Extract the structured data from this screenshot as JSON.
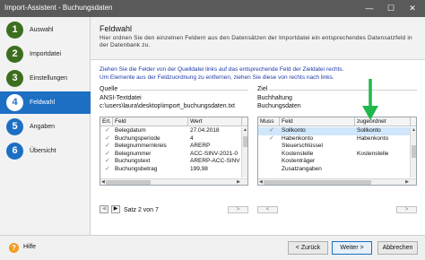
{
  "window": {
    "title": "Import-Assistent - Buchungsdaten",
    "minimize": "—",
    "maximize": "☐",
    "close": "✕"
  },
  "steps": [
    {
      "number": "1",
      "label": "Auswahl"
    },
    {
      "number": "2",
      "label": "Importdatei"
    },
    {
      "number": "3",
      "label": "Einstellungen"
    },
    {
      "number": "4",
      "label": "Feldwahl"
    },
    {
      "number": "5",
      "label": "Angaben"
    },
    {
      "number": "6",
      "label": "Übersicht"
    }
  ],
  "header": {
    "title": "Feldwahl",
    "description": "Hier ordnen Sie den einzelnen Feldern aus den Datensätzen der Importdatei ein entsprechendes Datensatzfeld in der Datenbank zu."
  },
  "instructions": [
    "Ziehen Sie die Felder von der Quelldatei links auf das entsprechende Feld der Zieldatei rechts.",
    "Um Elemente aus der Feldzuordnung zu entfernen, ziehen Sie diese von rechts nach links."
  ],
  "source": {
    "section_label": "Quelle",
    "name": "ANSI-Textdatei",
    "path": "c:\\users\\laura\\desktop\\import_buchungsdaten.txt",
    "columns": [
      "Erl.",
      "Feld",
      "Wert"
    ],
    "rows": [
      {
        "check": "✓",
        "field": "Belegdatum",
        "value": "27.04.2018"
      },
      {
        "check": "✓",
        "field": "Buchungsperiode",
        "value": "4"
      },
      {
        "check": "✓",
        "field": "Belegnummernkreis",
        "value": "ARERP"
      },
      {
        "check": "✓",
        "field": "Belegnummer",
        "value": "ACC-SINV-2021-0"
      },
      {
        "check": "✓",
        "field": "Buchungstext",
        "value": "ARERP-ACC-SINV"
      },
      {
        "check": "✓",
        "field": "Buchungsbetrag",
        "value": "199,98"
      }
    ],
    "record_status": "Satz 2 von 7",
    "arrow_button": ">"
  },
  "target": {
    "section_label": "Ziel",
    "name": "Buchhaltung",
    "subname": "Buchungsdaten",
    "columns": [
      "Muss",
      "Feld",
      "zugeordnet"
    ],
    "rows": [
      {
        "check": "✓",
        "field": "Sollkonto",
        "assigned": "Sollkonto"
      },
      {
        "check": "✓",
        "field": "Habenkonto",
        "assigned": "Habenkonto"
      },
      {
        "check": "",
        "field": "Steuerschlüssel",
        "assigned": ""
      },
      {
        "check": "",
        "field": "Kostenstelle",
        "assigned": "Kostenstelle"
      },
      {
        "check": "",
        "field": "Kostenträger",
        "assigned": ""
      },
      {
        "check": "",
        "field": "Zusatzangaben",
        "assigned": ""
      }
    ],
    "left_button": "<",
    "right_button": ">"
  },
  "footer": {
    "help_label": "Hilfe",
    "back_label": "< Zurück",
    "next_label": "Weiter >",
    "cancel_label": "Abbrechen"
  },
  "colors": {
    "accent": "#1d6fc4",
    "done_step": "#3c6e1f",
    "arrow": "#1fb84a",
    "help": "#f29b1f"
  }
}
